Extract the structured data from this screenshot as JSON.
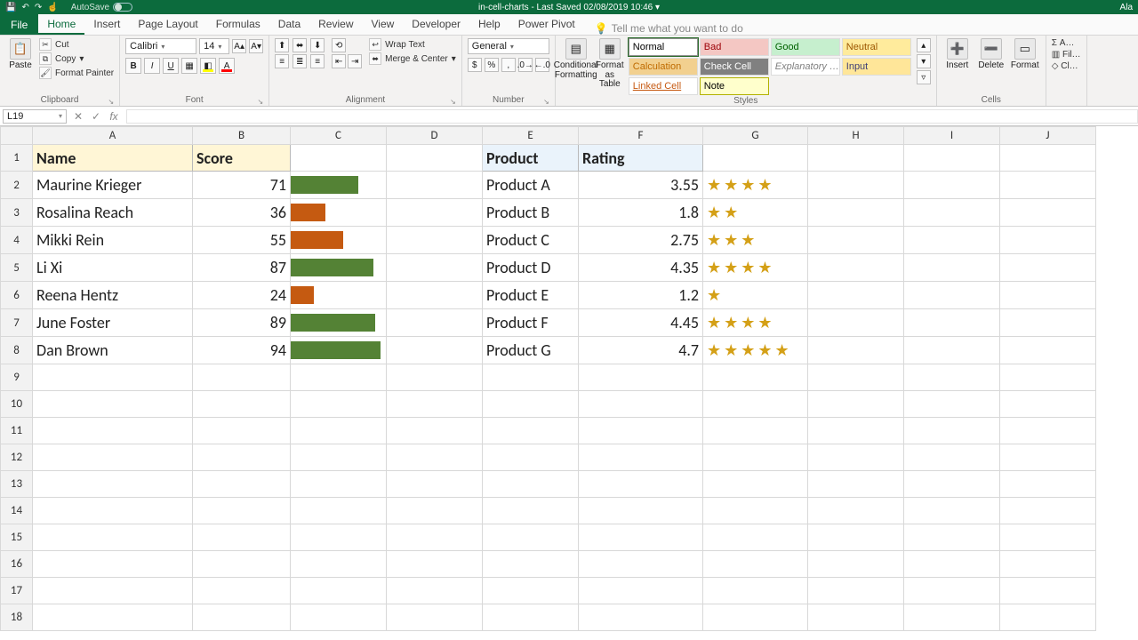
{
  "titlebar": {
    "autosave_label": "AutoSave",
    "doc_title": "in-cell-charts  -  Last Saved 02/08/2019 10:46 ▾",
    "right_label": "Ala"
  },
  "ribbon_tabs": {
    "file": "File",
    "tabs": [
      "Home",
      "Insert",
      "Page Layout",
      "Formulas",
      "Data",
      "Review",
      "View",
      "Developer",
      "Help",
      "Power Pivot"
    ],
    "active_index": 0,
    "tellme_placeholder": "Tell me what you want to do"
  },
  "ribbon": {
    "clipboard": {
      "paste": "Paste",
      "cut": "Cut",
      "copy": "Copy",
      "painter": "Format Painter",
      "label": "Clipboard"
    },
    "font": {
      "name": "Calibri",
      "size": "14",
      "label": "Font"
    },
    "alignment": {
      "wrap": "Wrap Text",
      "merge": "Merge & Center",
      "label": "Alignment"
    },
    "number": {
      "format": "General",
      "label": "Number"
    },
    "styles": {
      "cond": "Conditional Formatting",
      "table": "Format as Table",
      "label": "Styles",
      "gallery": [
        "Normal",
        "Bad",
        "Good",
        "Neutral",
        "Calculation",
        "Check Cell",
        "Explanatory …",
        "Input",
        "Linked Cell",
        "Note"
      ]
    },
    "cells": {
      "insert": "Insert",
      "delete": "Delete",
      "format": "Format",
      "label": "Cells"
    }
  },
  "gallery_styles": {
    "Normal": {
      "bg": "#ffffff",
      "fg": "#000000",
      "border": "#8f8f8f"
    },
    "Bad": {
      "bg": "#f4c7c3",
      "fg": "#9c0006"
    },
    "Good": {
      "bg": "#c6efce",
      "fg": "#006100"
    },
    "Neutral": {
      "bg": "#ffeb9c",
      "fg": "#9c5700"
    },
    "Calculation": {
      "bg": "#f2d08f",
      "fg": "#bf6b00"
    },
    "Check Cell": {
      "bg": "#808080",
      "fg": "#ffffff"
    },
    "Explanatory …": {
      "bg": "#ffffff",
      "fg": "#808080",
      "italic": true
    },
    "Input": {
      "bg": "#ffe699",
      "fg": "#3f3f76"
    },
    "Linked Cell": {
      "bg": "#ffffff",
      "fg": "#c65911",
      "underline": true
    },
    "Note": {
      "bg": "#ffffcc",
      "fg": "#000000",
      "border": "#b2b200"
    }
  },
  "formula_bar": {
    "cell_ref": "L19",
    "formula": ""
  },
  "sheet": {
    "columns": [
      "A",
      "B",
      "C",
      "D",
      "E",
      "F",
      "G",
      "H",
      "I",
      "J"
    ],
    "row_count": 18,
    "headers": {
      "A": "Name",
      "B": "Score",
      "E": "Product",
      "F": "Rating"
    },
    "data": [
      {
        "name": "Maurine Krieger",
        "score": 71,
        "product": "Product A",
        "rating": 3.55,
        "stars": 4
      },
      {
        "name": "Rosalina Reach",
        "score": 36,
        "product": "Product B",
        "rating": 1.8,
        "stars": 2
      },
      {
        "name": "Mikki Rein",
        "score": 55,
        "product": "Product C",
        "rating": 2.75,
        "stars": 3
      },
      {
        "name": "Li Xi",
        "score": 87,
        "product": "Product D",
        "rating": 4.35,
        "stars": 4
      },
      {
        "name": "Reena Hentz",
        "score": 24,
        "product": "Product E",
        "rating": 1.2,
        "stars": 1
      },
      {
        "name": "June Foster",
        "score": 89,
        "product": "Product F",
        "rating": 4.45,
        "stars": 4
      },
      {
        "name": "Dan Brown",
        "score": 94,
        "product": "Product G",
        "rating": 4.7,
        "stars": 5
      }
    ],
    "bar_threshold": 60,
    "bar_max": 100
  },
  "chart_data": [
    {
      "type": "bar",
      "title": "Score",
      "categories": [
        "Maurine Krieger",
        "Rosalina Reach",
        "Mikki Rein",
        "Li Xi",
        "Reena Hentz",
        "June Foster",
        "Dan Brown"
      ],
      "values": [
        71,
        36,
        55,
        87,
        24,
        89,
        94
      ],
      "xlabel": "Name",
      "ylabel": "Score",
      "ylim": [
        0,
        100
      ],
      "color_rule": ">60 → green, ≤60 → red"
    },
    {
      "type": "bar",
      "title": "Rating (stars)",
      "categories": [
        "Product A",
        "Product B",
        "Product C",
        "Product D",
        "Product E",
        "Product F",
        "Product G"
      ],
      "values": [
        3.55,
        1.8,
        2.75,
        4.35,
        1.2,
        4.45,
        4.7
      ],
      "xlabel": "Product",
      "ylabel": "Rating",
      "ylim": [
        0,
        5
      ]
    }
  ]
}
